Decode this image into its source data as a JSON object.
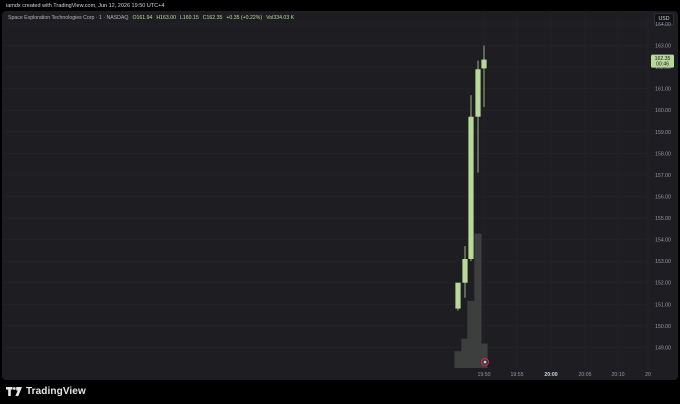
{
  "header": {
    "credit": "iamdx created with TradingView.com, Jun 12, 2026 19:50 UTC+4"
  },
  "legend": {
    "symbol": "Space Exploration Technologies Corp · 1 · NASDAQ",
    "open": "O161.94",
    "high": "H163.00",
    "low": "L160.15",
    "close": "C162.35",
    "change": "+0.35 (+0.22%)",
    "volume": "Vol334.03 K"
  },
  "currency_label": "USD",
  "price_badge": {
    "price": "162.35",
    "countdown": "00:46"
  },
  "brand": {
    "name": "TradingView"
  },
  "colors": {
    "up_candle": "#b8d99a",
    "volume": "#3d3f3e",
    "grid": "#27272c",
    "axis_text": "#9598a1"
  },
  "chart_data": {
    "type": "candlestick",
    "y_ticks": [
      "164.00",
      "163.00",
      "162.00",
      "161.00",
      "160.00",
      "159.00",
      "158.00",
      "157.00",
      "156.00",
      "155.00",
      "154.00",
      "153.00",
      "152.00",
      "151.00",
      "150.00",
      "149.00"
    ],
    "x_ticks": [
      "19:50",
      "19:55",
      "20:00",
      "20:05",
      "20:10",
      "20"
    ],
    "ylim": [
      148.6,
      164.0
    ],
    "candles": [
      {
        "open": 150.8,
        "high": 152.0,
        "low": 150.7,
        "close": 152.0
      },
      {
        "open": 152.0,
        "high": 153.7,
        "low": 151.3,
        "close": 153.1
      },
      {
        "open": 153.1,
        "high": 160.7,
        "low": 153.0,
        "close": 159.7
      },
      {
        "open": 159.7,
        "high": 162.3,
        "low": 157.1,
        "close": 161.9
      },
      {
        "open": 161.94,
        "high": 163.0,
        "low": 160.15,
        "close": 162.35
      }
    ],
    "volumes": [
      40,
      70,
      160,
      320,
      58
    ],
    "volume_max": 400,
    "grid": true
  }
}
